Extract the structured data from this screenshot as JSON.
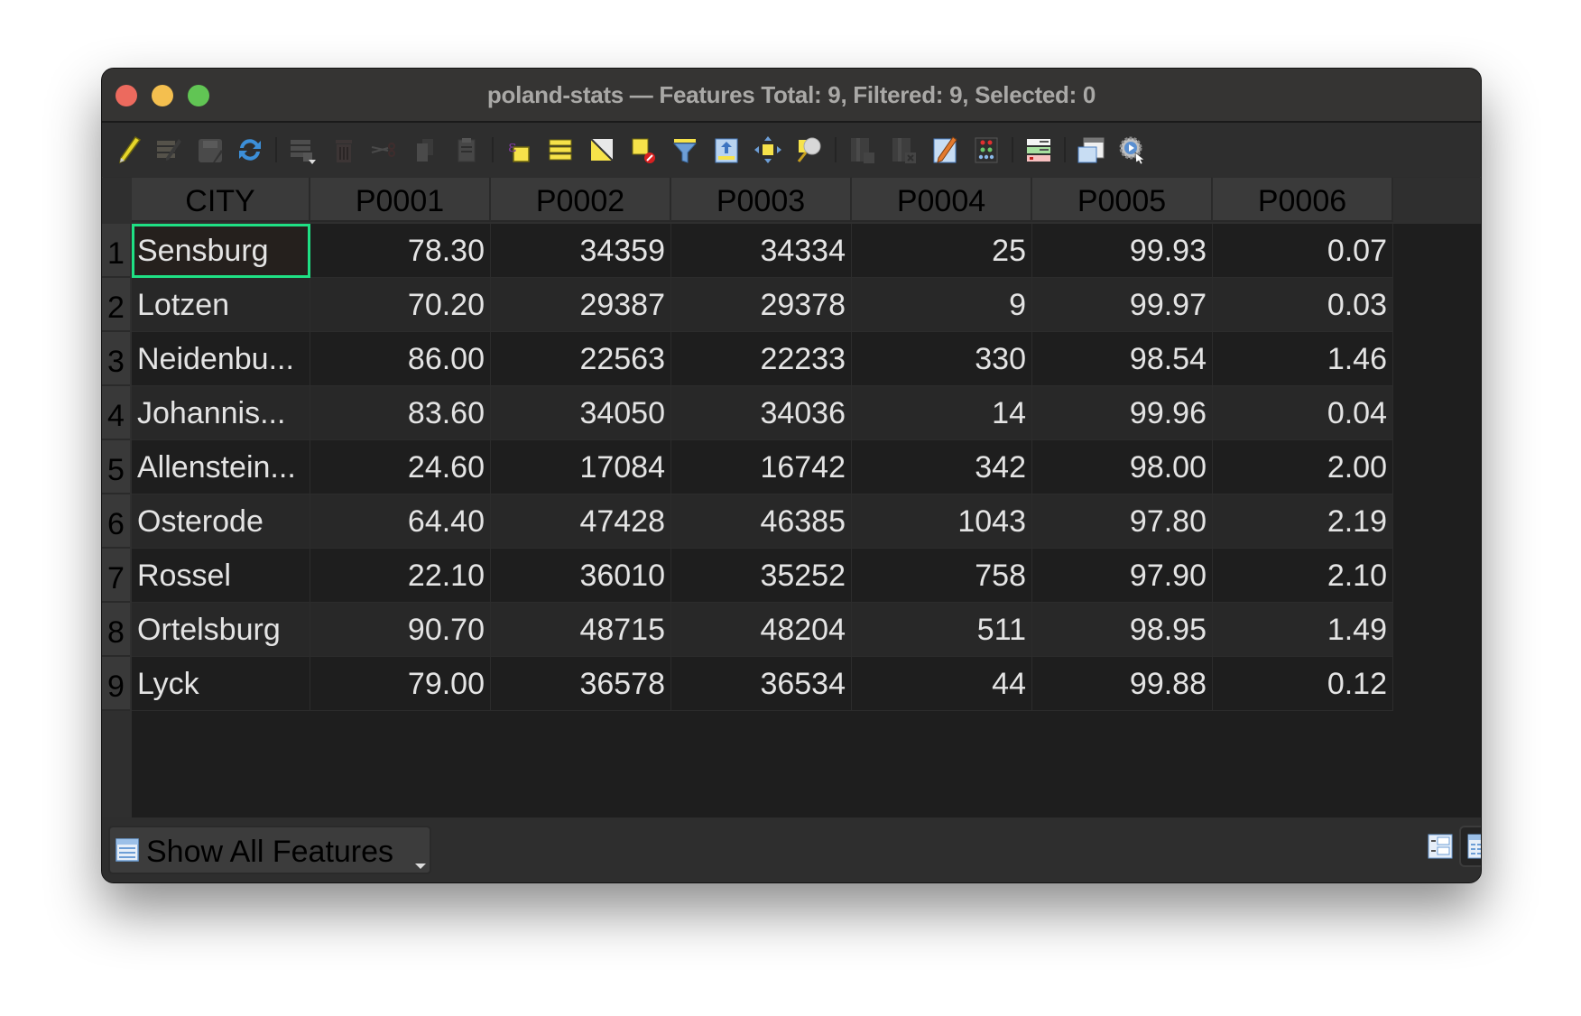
{
  "window": {
    "title": "poland-stats — Features Total: 9, Filtered: 9, Selected: 0"
  },
  "toolbar": {
    "items": [
      {
        "name": "toggle-editing",
        "icon": "pencil-icon"
      },
      {
        "name": "multi-edit",
        "icon": "multi-edit-icon"
      },
      {
        "name": "save-edits",
        "icon": "save-edits-icon"
      },
      {
        "name": "reload",
        "icon": "refresh-icon"
      },
      {
        "name": "add-feature",
        "icon": "add-feature-icon"
      },
      {
        "name": "delete-selected",
        "icon": "trash-icon"
      },
      {
        "name": "cut",
        "icon": "scissors-icon"
      },
      {
        "name": "copy",
        "icon": "copy-icon"
      },
      {
        "name": "paste",
        "icon": "paste-icon"
      },
      {
        "name": "select-by-expression",
        "icon": "select-expression-icon"
      },
      {
        "name": "select-all",
        "icon": "select-all-icon"
      },
      {
        "name": "invert-selection",
        "icon": "invert-selection-icon"
      },
      {
        "name": "deselect-all",
        "icon": "deselect-icon"
      },
      {
        "name": "filter-select",
        "icon": "filter-icon"
      },
      {
        "name": "move-selection-top",
        "icon": "move-top-icon"
      },
      {
        "name": "pan-to-selected",
        "icon": "pan-icon"
      },
      {
        "name": "zoom-to-selected",
        "icon": "zoom-magnifier-icon"
      },
      {
        "name": "new-field",
        "icon": "new-field-icon"
      },
      {
        "name": "delete-field",
        "icon": "delete-field-icon"
      },
      {
        "name": "field-calculator",
        "icon": "field-calculator-icon"
      },
      {
        "name": "conditional-formatting",
        "icon": "conditional-format-icon"
      },
      {
        "name": "organize-columns",
        "icon": "organize-columns-icon"
      },
      {
        "name": "dock-table",
        "icon": "dock-icon"
      },
      {
        "name": "actions",
        "icon": "actions-gear-icon"
      }
    ]
  },
  "table": {
    "columns": [
      "CITY",
      "P0001",
      "P0002",
      "P0003",
      "P0004",
      "P0005",
      "P0006"
    ],
    "rows": [
      {
        "num": "1",
        "cells": [
          "Sensburg",
          "78.30",
          "34359",
          "34334",
          "25",
          "99.93",
          "0.07"
        ]
      },
      {
        "num": "2",
        "cells": [
          "Lotzen",
          "70.20",
          "29387",
          "29378",
          "9",
          "99.97",
          "0.03"
        ]
      },
      {
        "num": "3",
        "cells": [
          "Neidenbu...",
          "86.00",
          "22563",
          "22233",
          "330",
          "98.54",
          "1.46"
        ]
      },
      {
        "num": "4",
        "cells": [
          "Johannis...",
          "83.60",
          "34050",
          "34036",
          "14",
          "99.96",
          "0.04"
        ]
      },
      {
        "num": "5",
        "cells": [
          "Allenstein...",
          "24.60",
          "17084",
          "16742",
          "342",
          "98.00",
          "2.00"
        ]
      },
      {
        "num": "6",
        "cells": [
          "Osterode",
          "64.40",
          "47428",
          "46385",
          "1043",
          "97.80",
          "2.19"
        ]
      },
      {
        "num": "7",
        "cells": [
          "Rossel",
          "22.10",
          "36010",
          "35252",
          "758",
          "97.90",
          "2.10"
        ]
      },
      {
        "num": "8",
        "cells": [
          "Ortelsburg",
          "90.70",
          "48715",
          "48204",
          "511",
          "98.95",
          "1.49"
        ]
      },
      {
        "num": "9",
        "cells": [
          "Lyck",
          "79.00",
          "36578",
          "36534",
          "44",
          "99.88",
          "0.12"
        ]
      }
    ],
    "current_cell": {
      "row": 1,
      "column": "CITY"
    },
    "current_cell_color": "#1fe084"
  },
  "footer": {
    "filter_label": "Show All Features",
    "form_view": "form-view-icon",
    "table_view": "table-view-icon"
  }
}
